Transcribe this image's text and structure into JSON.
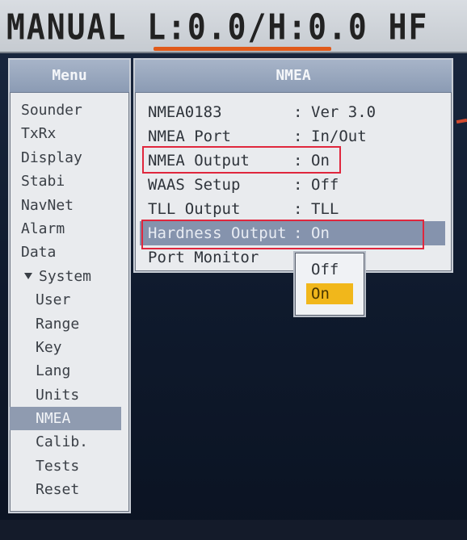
{
  "header": {
    "status_text": "MANUAL L:0.0/H:0.0 HF"
  },
  "menu": {
    "title": "Menu",
    "items": [
      {
        "label": "Sounder"
      },
      {
        "label": "TxRx"
      },
      {
        "label": "Display"
      },
      {
        "label": "Stabi"
      },
      {
        "label": "NavNet"
      },
      {
        "label": "Alarm"
      },
      {
        "label": "Data"
      },
      {
        "label": "System"
      },
      {
        "label": "User"
      },
      {
        "label": "Range"
      },
      {
        "label": "Key"
      },
      {
        "label": "Lang"
      },
      {
        "label": "Units"
      },
      {
        "label": "NMEA"
      },
      {
        "label": "Calib."
      },
      {
        "label": "Tests"
      },
      {
        "label": "Reset"
      }
    ],
    "selected": "NMEA"
  },
  "nmea": {
    "title": "NMEA",
    "separator": ":",
    "rows": [
      {
        "label": "NMEA0183",
        "value": "Ver 3.0"
      },
      {
        "label": "NMEA Port",
        "value": "In/Out"
      },
      {
        "label": "NMEA Output",
        "value": "On"
      },
      {
        "label": "WAAS Setup",
        "value": "Off"
      },
      {
        "label": "TLL Output",
        "value": "TLL"
      },
      {
        "label": "Hardness Output",
        "value": "On"
      },
      {
        "label": "Port Monitor",
        "value": ""
      }
    ]
  },
  "popup": {
    "options": [
      {
        "label": "Off"
      },
      {
        "label": "On"
      }
    ],
    "selected": "On"
  },
  "colors": {
    "highlight": "#8593ad",
    "popup_selected": "#f1b71b",
    "annotation": "#e0273d",
    "header_accent": "#e05a1a"
  }
}
